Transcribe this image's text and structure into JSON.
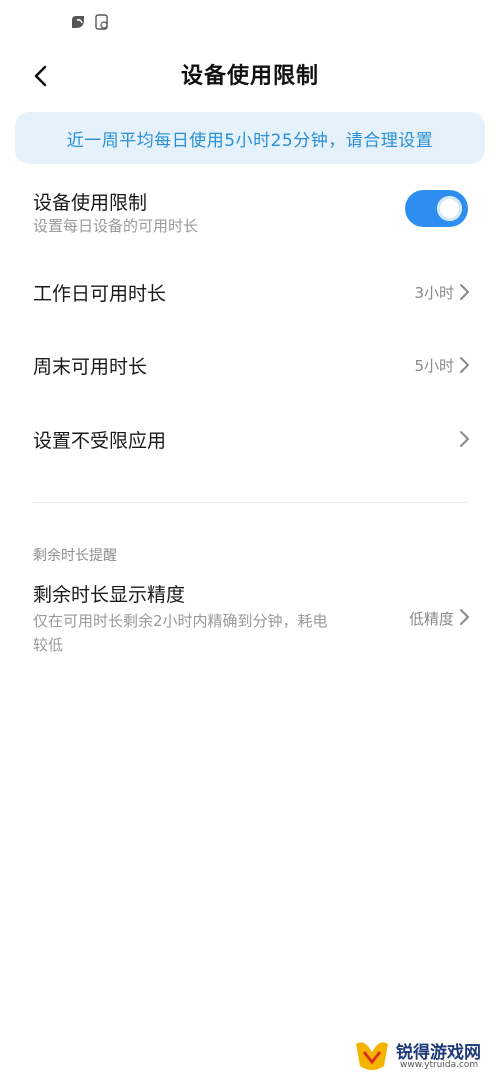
{
  "header": {
    "title": "设备使用限制"
  },
  "banner": {
    "text": "近一周平均每日使用5小时25分钟，请合理设置"
  },
  "limit_row": {
    "title": "设备使用限制",
    "subtitle": "设置每日设备的可用时长",
    "enabled": true
  },
  "rows": [
    {
      "title": "工作日可用时长",
      "value": "3小时"
    },
    {
      "title": "周末可用时长",
      "value": "5小时"
    },
    {
      "title": "设置不受限应用",
      "value": ""
    }
  ],
  "reminder": {
    "section_title": "剩余时长提醒",
    "title": "剩余时长显示精度",
    "subtitle_line1": "仅在可用时长剩余2小时内精确到分钟，耗电",
    "subtitle_line2": "较低",
    "value": "低精度"
  },
  "watermark": {
    "text": "锐得游戏网",
    "url": "www.ytruida.com"
  },
  "colors": {
    "accent": "#2d8ef0",
    "banner_bg": "#e5f2fb",
    "banner_text": "#2b8fd6"
  }
}
